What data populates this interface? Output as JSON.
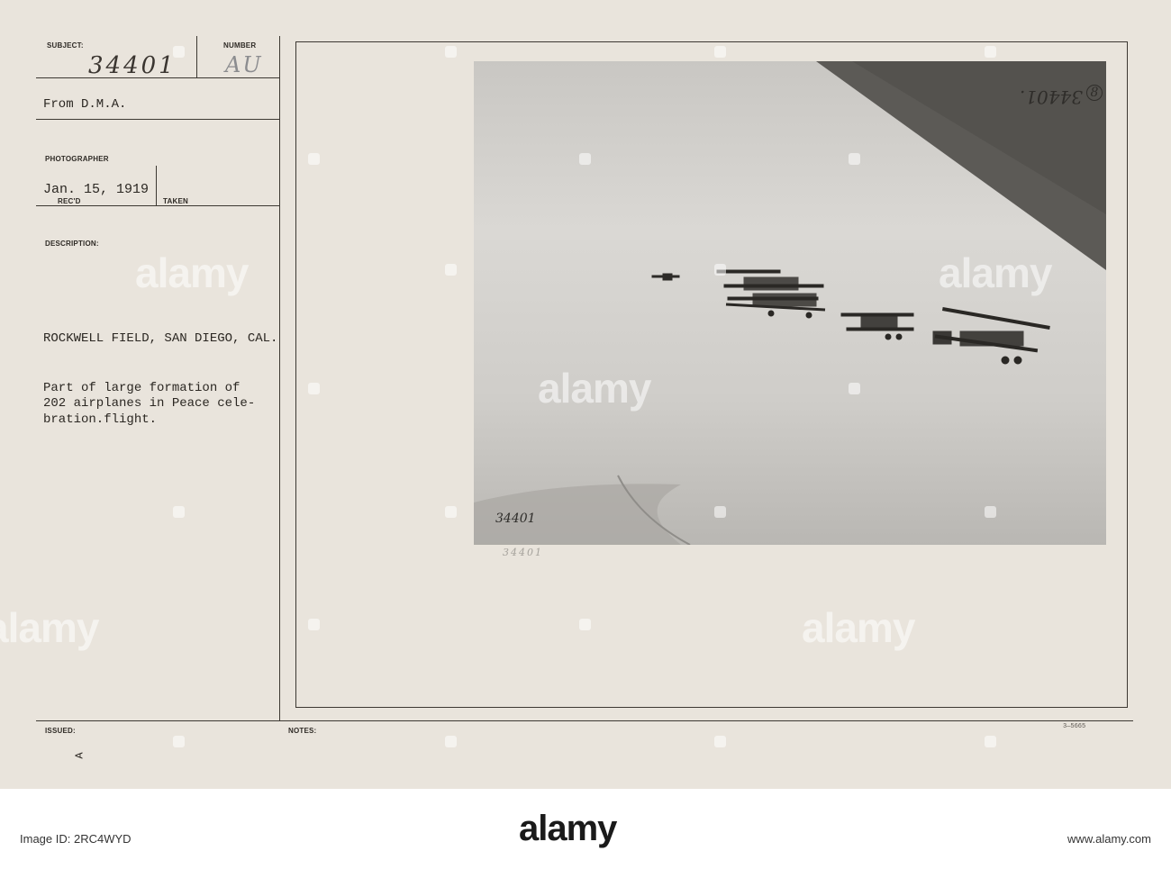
{
  "card": {
    "labels": {
      "subject": "SUBJECT:",
      "number": "NUMBER",
      "photographer": "PHOTOGRAPHER",
      "recd": "REC'D",
      "taken": "TAKEN",
      "description": "DESCRIPTION:",
      "issued": "ISSUED:",
      "notes": "NOTES:"
    },
    "subject_number": "34401",
    "number_code": "AU",
    "from": "From D.M.A.",
    "date": "Jan. 15, 1919",
    "location": "ROCKWELL FIELD, SAN DIEGO, CAL.",
    "description_lines": [
      "Part of large formation of",
      "202 airplanes in Peace cele-",
      "bration.flight."
    ],
    "issued_mark": "A",
    "form_code": "3—5665"
  },
  "photo": {
    "corner_number": "34401.",
    "corner_mark": "8",
    "bottom_number": "34401"
  },
  "below_photo_number": "34401",
  "watermark": {
    "text": "alamy",
    "color": "#ffffff"
  },
  "footer": {
    "logo": "alamy",
    "image_id_label": "Image ID: 2RC4WYD",
    "site": "www.alamy.com"
  }
}
